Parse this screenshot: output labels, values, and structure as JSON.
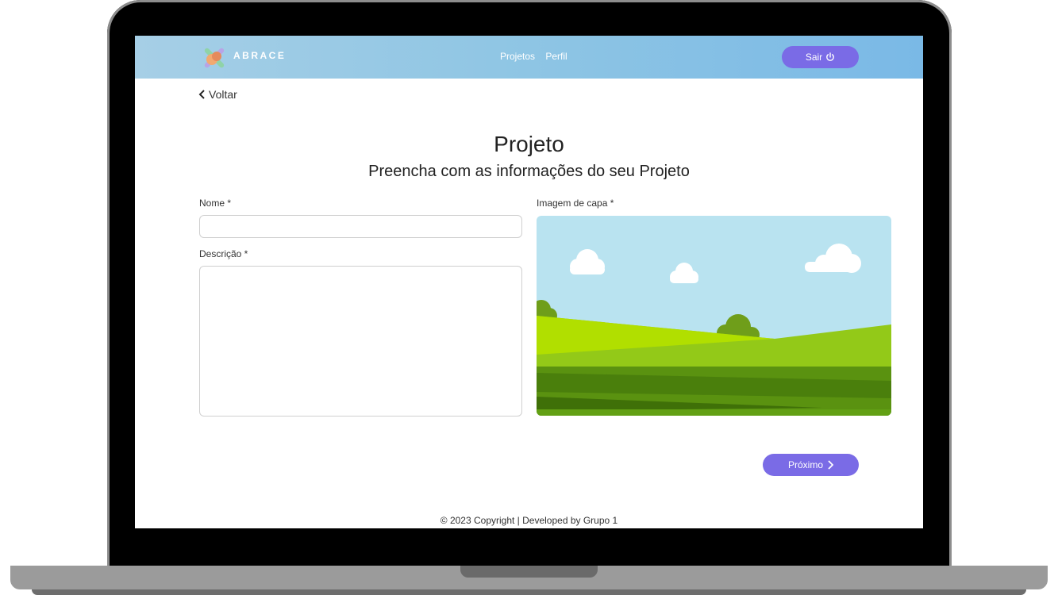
{
  "brand": {
    "name": "ABRACE"
  },
  "nav": {
    "links": [
      "Projetos",
      "Perfil"
    ],
    "logout_label": "Sair"
  },
  "back": {
    "label": "Voltar"
  },
  "page": {
    "title": "Projeto",
    "subtitle": "Preencha com as informações do seu Projeto"
  },
  "form": {
    "name_label": "Nome *",
    "name_value": "",
    "description_label": "Descrição *",
    "description_value": "",
    "cover_label": "Imagem de capa *"
  },
  "actions": {
    "next_label": "Próximo"
  },
  "footer": {
    "text": "© 2023 Copyright | Developed by Grupo 1"
  },
  "colors": {
    "accent": "#7a6be6",
    "navbar": "#8ec5e4"
  },
  "icons": [
    "logo-icon",
    "power-icon",
    "chevron-left-icon",
    "chevron-right-icon"
  ]
}
